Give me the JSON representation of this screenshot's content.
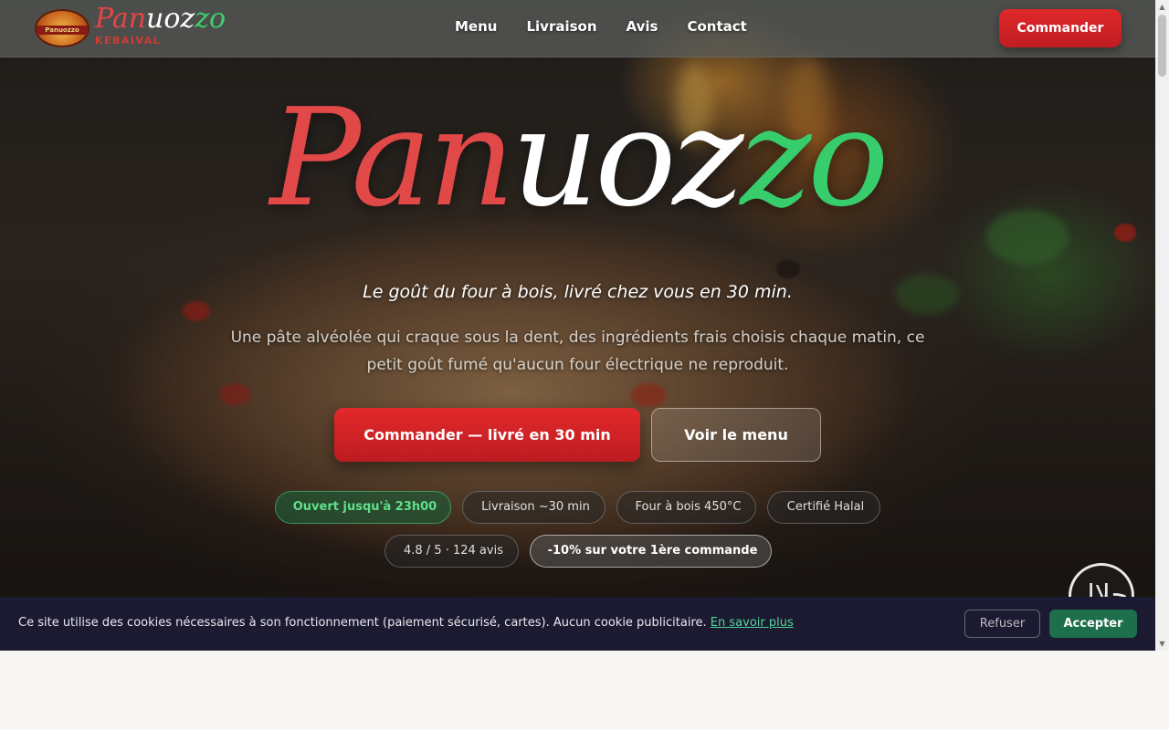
{
  "nav": {
    "logo": {
      "part1": "Pan",
      "part2": "uoz",
      "part3": "zo",
      "subtitle": "KEBAIVAL",
      "badge_text": "Panuozzo"
    },
    "links": [
      "Menu",
      "Livraison",
      "Avis",
      "Contact"
    ],
    "cta": "Commander"
  },
  "hero": {
    "brand": {
      "part1": "Pan",
      "part2": "uoz",
      "part3": "zo"
    },
    "tagline": "Le goût du four à bois, livré chez vous en 30 min.",
    "description": "Une pâte alvéolée qui craque sous la dent, des ingrédients frais choisis chaque matin, ce petit goût fumé qu'aucun four électrique ne reproduit.",
    "primary_button": "Commander — livré en 30 min",
    "secondary_button": "Voir le menu",
    "badges": [
      {
        "icon": "",
        "text": "Ouvert jusqu'à 23h00"
      },
      {
        "icon": "",
        "text": "Livraison ~30 min"
      },
      {
        "icon": "",
        "text": "Four à bois 450°C"
      },
      {
        "icon": "",
        "text": "Certifié Halal"
      },
      {
        "icon": "",
        "text": "4.8 / 5 · 124 avis"
      },
      {
        "icon": "",
        "text": "-10% sur votre 1ère commande"
      }
    ],
    "halal_badge": "حلال"
  },
  "cookie": {
    "text": "Ce site utilise des cookies nécessaires à son fonctionnement (paiement sécurisé, cartes). Aucun cookie publicitaire.",
    "link": "En savoir plus",
    "refuse": "Refuser",
    "accept": "Accepter"
  },
  "colors": {
    "brand_red": "#e14848",
    "brand_green": "#37cd6c",
    "cta_red": "#d0222a",
    "cookie_bg": "#1b1a30",
    "accept_green": "#1d6e4b"
  }
}
